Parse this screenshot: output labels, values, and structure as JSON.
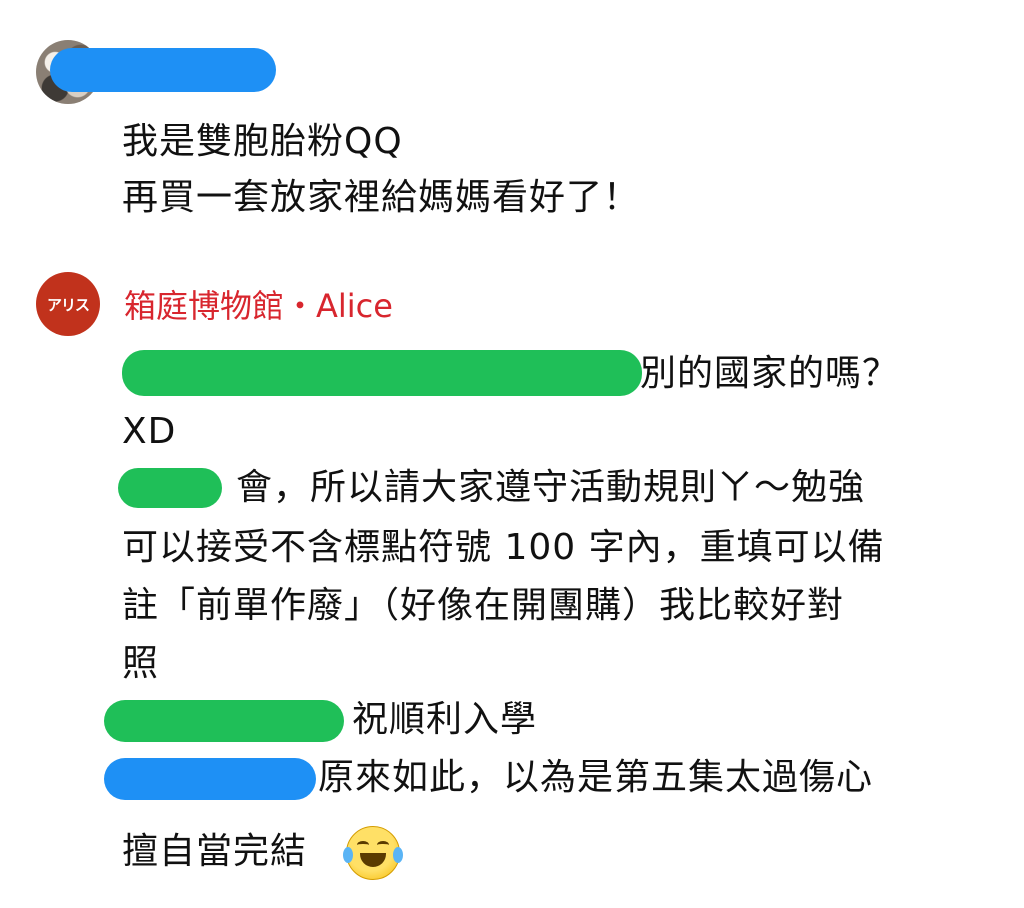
{
  "comment_1": {
    "lines": [
      "我是雙胞胎粉QQ",
      "再買一套放家裡給媽媽看好了！"
    ]
  },
  "comment_2": {
    "avatar_text": "アリス",
    "author": "箱庭博物館・Alice",
    "lines": [
      "別的國家的嗎？",
      "XD",
      "會，所以請大家遵守活動規則ㄚ～勉強",
      "可以接受不含標點符號 100 字內，重填可以備",
      "註「前單作廢」（好像在開團購）我比較好對",
      "照",
      "祝順利入學",
      "原來如此，以為是第五集太過傷心",
      "擅自當完結"
    ],
    "emoji": "face-with-tears-of-joy-icon"
  },
  "colors": {
    "author_red": "#d8262e",
    "redact_blue": "#1e90f5",
    "redact_green": "#1fbf58",
    "avatar_red": "#c1321c"
  }
}
